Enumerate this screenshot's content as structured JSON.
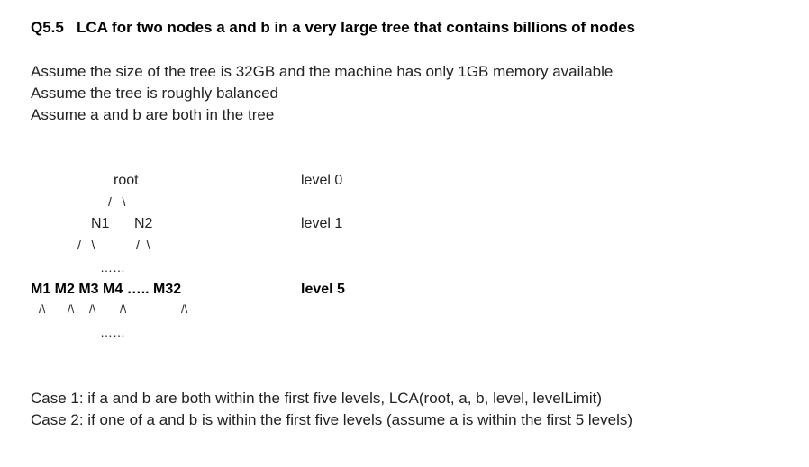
{
  "title": "Q5.5   LCA for two nodes a and b in a very large tree that contains billions of nodes",
  "assumptions": [
    "Assume the size of the tree is 32GB and the machine has only 1GB memory available",
    "Assume the tree is roughly balanced",
    "Assume a and b are both in the tree"
  ],
  "tree": {
    "root": "root",
    "root_branches": "/   \\",
    "level0": "level 0",
    "n1": "N1",
    "n2": "N2",
    "level1": "level 1",
    "n1_branches": "/   \\",
    "n2_branches": "/  \\",
    "dots_upper": "……",
    "m_row": "M1 M2 M3 M4 ….. M32",
    "level5": "level 5",
    "m_branches_1": "/\\",
    "m_branches_2": "/\\",
    "m_branches_3": "/\\",
    "m_branches_4": "/\\",
    "m_branches_32": "/\\",
    "dots_lower": "……"
  },
  "cases": [
    "Case 1: if a and b are both within the first five levels, LCA(root, a, b, level, levelLimit)",
    "Case 2: if one of a and b is within the first five levels (assume a is within the first 5 levels)"
  ]
}
